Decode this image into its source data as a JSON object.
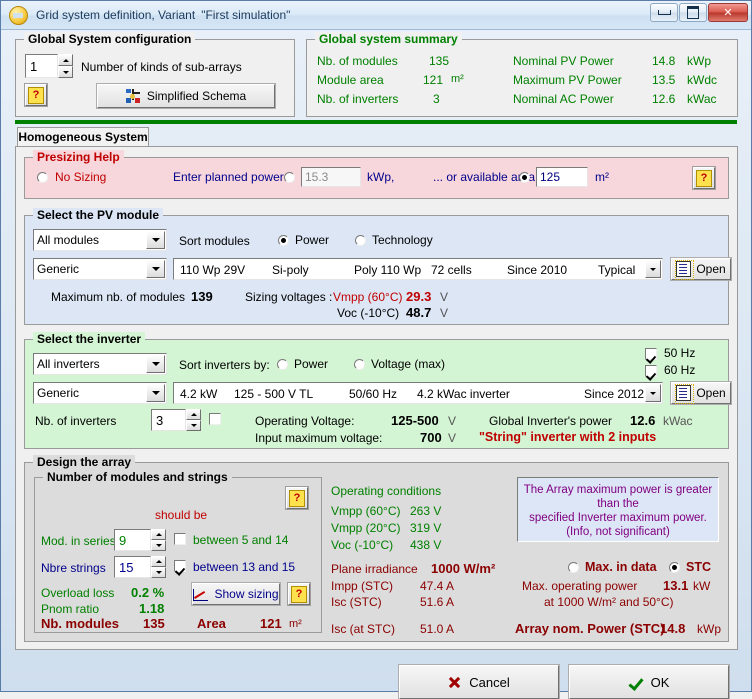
{
  "window": {
    "title": "Grid system definition, Variant",
    "variant": "\"First simulation\"",
    "icon": "pvsyst-sun-icon",
    "buttons": {
      "minimize": "minimize-button",
      "maximize": "maximize-button",
      "close": "✕"
    }
  },
  "global_config": {
    "legend": "Global System configuration",
    "sub_arrays_value": "1",
    "sub_arrays_label": "Number of kinds of sub-arrays",
    "help": "?",
    "schema_button": "Simplified Schema"
  },
  "global_summary": {
    "legend": "Global system summary",
    "rows_left": [
      {
        "label": "Nb. of modules",
        "value": "135",
        "unit": ""
      },
      {
        "label": "Module area",
        "value": "121",
        "unit": "m²"
      },
      {
        "label": "Nb. of inverters",
        "value": "3",
        "unit": ""
      }
    ],
    "rows_right": [
      {
        "label": "Nominal PV Power",
        "value": "14.8",
        "unit": "kWp"
      },
      {
        "label": "Maximum PV Power",
        "value": "13.5",
        "unit": "kWdc"
      },
      {
        "label": "Nominal AC Power",
        "value": "12.6",
        "unit": "kWac"
      }
    ]
  },
  "tab": {
    "label": "Homogeneous System"
  },
  "presizing": {
    "legend": "Presizing Help",
    "no_sizing_label": "No Sizing",
    "no_sizing_selected": false,
    "planned_power_label": "Enter planned power",
    "planned_power_selected": false,
    "planned_power_value": "15.3",
    "planned_power_unit": "kWp,",
    "area_label": "... or available area",
    "area_selected": true,
    "area_value": "125",
    "area_unit": "m²",
    "help": "?"
  },
  "pv_module": {
    "legend": "Select the PV module",
    "filter": "All modules",
    "sort_label": "Sort modules",
    "sort_power": "Power",
    "sort_power_selected": true,
    "sort_technology": "Technology",
    "sort_technology_selected": false,
    "manufacturer": "Generic",
    "model_power": "110 Wp 29V",
    "model_tech": "Si-poly",
    "model_desc": "Poly 110 Wp",
    "model_cells": "72 cells",
    "model_since": "Since 2010",
    "model_quality": "Typical",
    "open_button": "Open",
    "max_modules_label": "Maximum nb. of modules",
    "max_modules_value": "139",
    "sizing_voltages_label": "Sizing voltages :",
    "vmpp_label": "Vmpp (60°C)",
    "vmpp_value": "29.3",
    "vmpp_unit": "V",
    "voc_label": "Voc  (-10°C)",
    "voc_value": "48.7",
    "voc_unit": "V"
  },
  "inverter": {
    "legend": "Select the inverter",
    "filter": "All inverters",
    "sort_label": "Sort inverters by:",
    "sort_power": "Power",
    "sort_power_selected": false,
    "sort_voltage": "Voltage (max)",
    "sort_voltage_selected": false,
    "freq_50_label": "50 Hz",
    "freq_50_checked": true,
    "freq_60_label": "60 Hz",
    "freq_60_checked": true,
    "manufacturer": "Generic",
    "model_power": "4.2 kW",
    "model_voltage": "125 - 500 V  TL",
    "model_freq": "50/60 Hz",
    "model_desc": "4.2 kWac inverter",
    "model_since": "Since 2012",
    "open_button": "Open",
    "nb_inverters_label": "Nb. of inverters",
    "nb_inverters_value": "3",
    "nb_inverters_checkbox": false,
    "operating_voltage_label": "Operating Voltage:",
    "operating_voltage_value": "125-500",
    "operating_voltage_unit": "V",
    "input_max_voltage_label": "Input maximum voltage:",
    "input_max_voltage_value": "700",
    "input_max_voltage_unit": "V",
    "global_power_label": "Global Inverter's power",
    "global_power_value": "12.6",
    "global_power_unit": "kWac",
    "string_note": "\"String\" inverter with 2 inputs"
  },
  "design_array": {
    "legend": "Design the array",
    "modules_strings": {
      "legend": "Number of modules and strings",
      "help": "?",
      "should_be": "should be",
      "mod_series_label": "Mod. in series",
      "mod_series_value": "9",
      "mod_series_range": "between 5 and 14",
      "mod_series_checked": false,
      "nbre_strings_label": "Nbre strings",
      "nbre_strings_value": "15",
      "nbre_strings_range": "between 13 and 15",
      "nbre_strings_checked": true,
      "overload_loss_label": "Overload loss",
      "overload_loss_value": "0.2 %",
      "pnom_ratio_label": "Pnom ratio",
      "pnom_ratio_value": "1.18",
      "show_sizing_button": "Show sizing",
      "show_sizing_help": "?",
      "nb_modules_label": "Nb. modules",
      "nb_modules_value": "135",
      "area_label": "Area",
      "area_value": "121",
      "area_unit": "m²"
    },
    "operating_conditions": {
      "title": "Operating conditions",
      "rows": [
        {
          "label": "Vmpp (60°C)",
          "value": "263 V"
        },
        {
          "label": "Vmpp (20°C)",
          "value": "319 V"
        },
        {
          "label": "Voc  (-10°C)",
          "value": "438 V"
        }
      ],
      "plane_irradiance_label": "Plane irradiance",
      "plane_irradiance_value": "1000 W/m²",
      "impp_label": "Impp (STC)",
      "impp_value": "47.4 A",
      "isc_label": "Isc  (STC)",
      "isc_value": "51.6 A",
      "isc_stc_label": "Isc (at STC)",
      "isc_stc_value": "51.0 A"
    },
    "info_message": "The Array maximum power is greater than the specified Inverter maximum power. (Info, not significant)",
    "info_line1": "The Array maximum power is greater than the",
    "info_line2": "specified Inverter maximum power.",
    "info_line3": "(Info, not significant)",
    "max_in_data_label": "Max. in data",
    "max_in_data_selected": false,
    "stc_label": "STC",
    "stc_selected": true,
    "max_op_power_label": "Max. operating power",
    "max_op_power_cond": "at 1000 W/m² and 50°C)",
    "max_op_power_value": "13.1",
    "max_op_power_unit": "kW",
    "array_nom_power_label": "Array nom. Power (STC)",
    "array_nom_power_value": "14.8",
    "array_nom_power_unit": "kWp"
  },
  "footer": {
    "cancel_label": "Cancel",
    "ok_label": "OK"
  },
  "colors": {
    "green": "#008000",
    "red": "#c00000",
    "dark_red": "#8b0000",
    "purple": "#800080",
    "navy": "#000080",
    "pink_panel": "#f7d7dc",
    "blue_panel": "#dce6f5",
    "green_panel": "#d4f5d4",
    "gray_panel": "#dcdcdc"
  }
}
